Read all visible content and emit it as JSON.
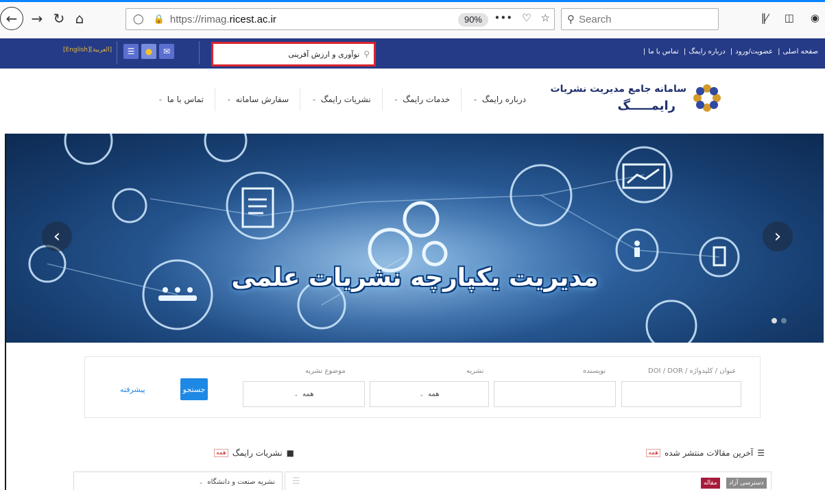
{
  "browser": {
    "url_prefix": "https://rimag.",
    "url_domain": "ricest.ac.ir",
    "zoom": "90%",
    "search_placeholder": "Search",
    "more_glyph": "•••",
    "icons": [
      "back-icon",
      "forward-icon",
      "reload-icon",
      "home-icon",
      "shield-icon",
      "lock-icon",
      "pocket-icon",
      "bookmark-star-icon",
      "search-icon",
      "library-icon",
      "sidebar-icon",
      "account-icon"
    ]
  },
  "topbar": {
    "links": [
      "صفحه اصلی",
      "عضویت/ورود",
      "درباره رایمگ",
      "تماس با ما"
    ],
    "languages": "[English][العربية]",
    "search_query": "نوآوری و ارزش آفرینی"
  },
  "header": {
    "logo_line1": "سامانه جامع مدیریت نشریات",
    "logo_line2": "رایمـــــگ",
    "nav": [
      {
        "label": "درباره رایمگ"
      },
      {
        "label": "خدمات رایمگ"
      },
      {
        "label": "نشریات رایمگ"
      },
      {
        "label": "سفارش سامانه"
      },
      {
        "label": "تماس با ما"
      }
    ]
  },
  "hero": {
    "slogan": "مدیریت یکپارچه نشریات علمی",
    "prev": "‹",
    "next": "›",
    "slide_count": 2,
    "active_slide": 1
  },
  "search": {
    "label_title": "عنوان / کلیدواژه / DOI / DOR",
    "label_author": "نویسنده",
    "label_journal": "نشریه",
    "label_subject": "موضوع نشریه",
    "journal_value": "همه",
    "subject_value": "همه",
    "search_button": "جستجو",
    "advanced_link": "پیشرفته"
  },
  "latest": {
    "title": "آخرین مقالات منتشر شده",
    "tag": "همه",
    "badge_type": "مقاله",
    "badge_access": "دسترسی آزاد"
  },
  "journals": {
    "title": "نشریات رایمگ",
    "tag": "همه",
    "select_value": "نشریه صنعت و دانشگاه"
  },
  "colors": {
    "topbar": "#253b87",
    "highlight": "#d9232d",
    "accent": "#1e88e5",
    "badge_red": "#a61c3c",
    "badge_gray": "#8a8a8a"
  }
}
